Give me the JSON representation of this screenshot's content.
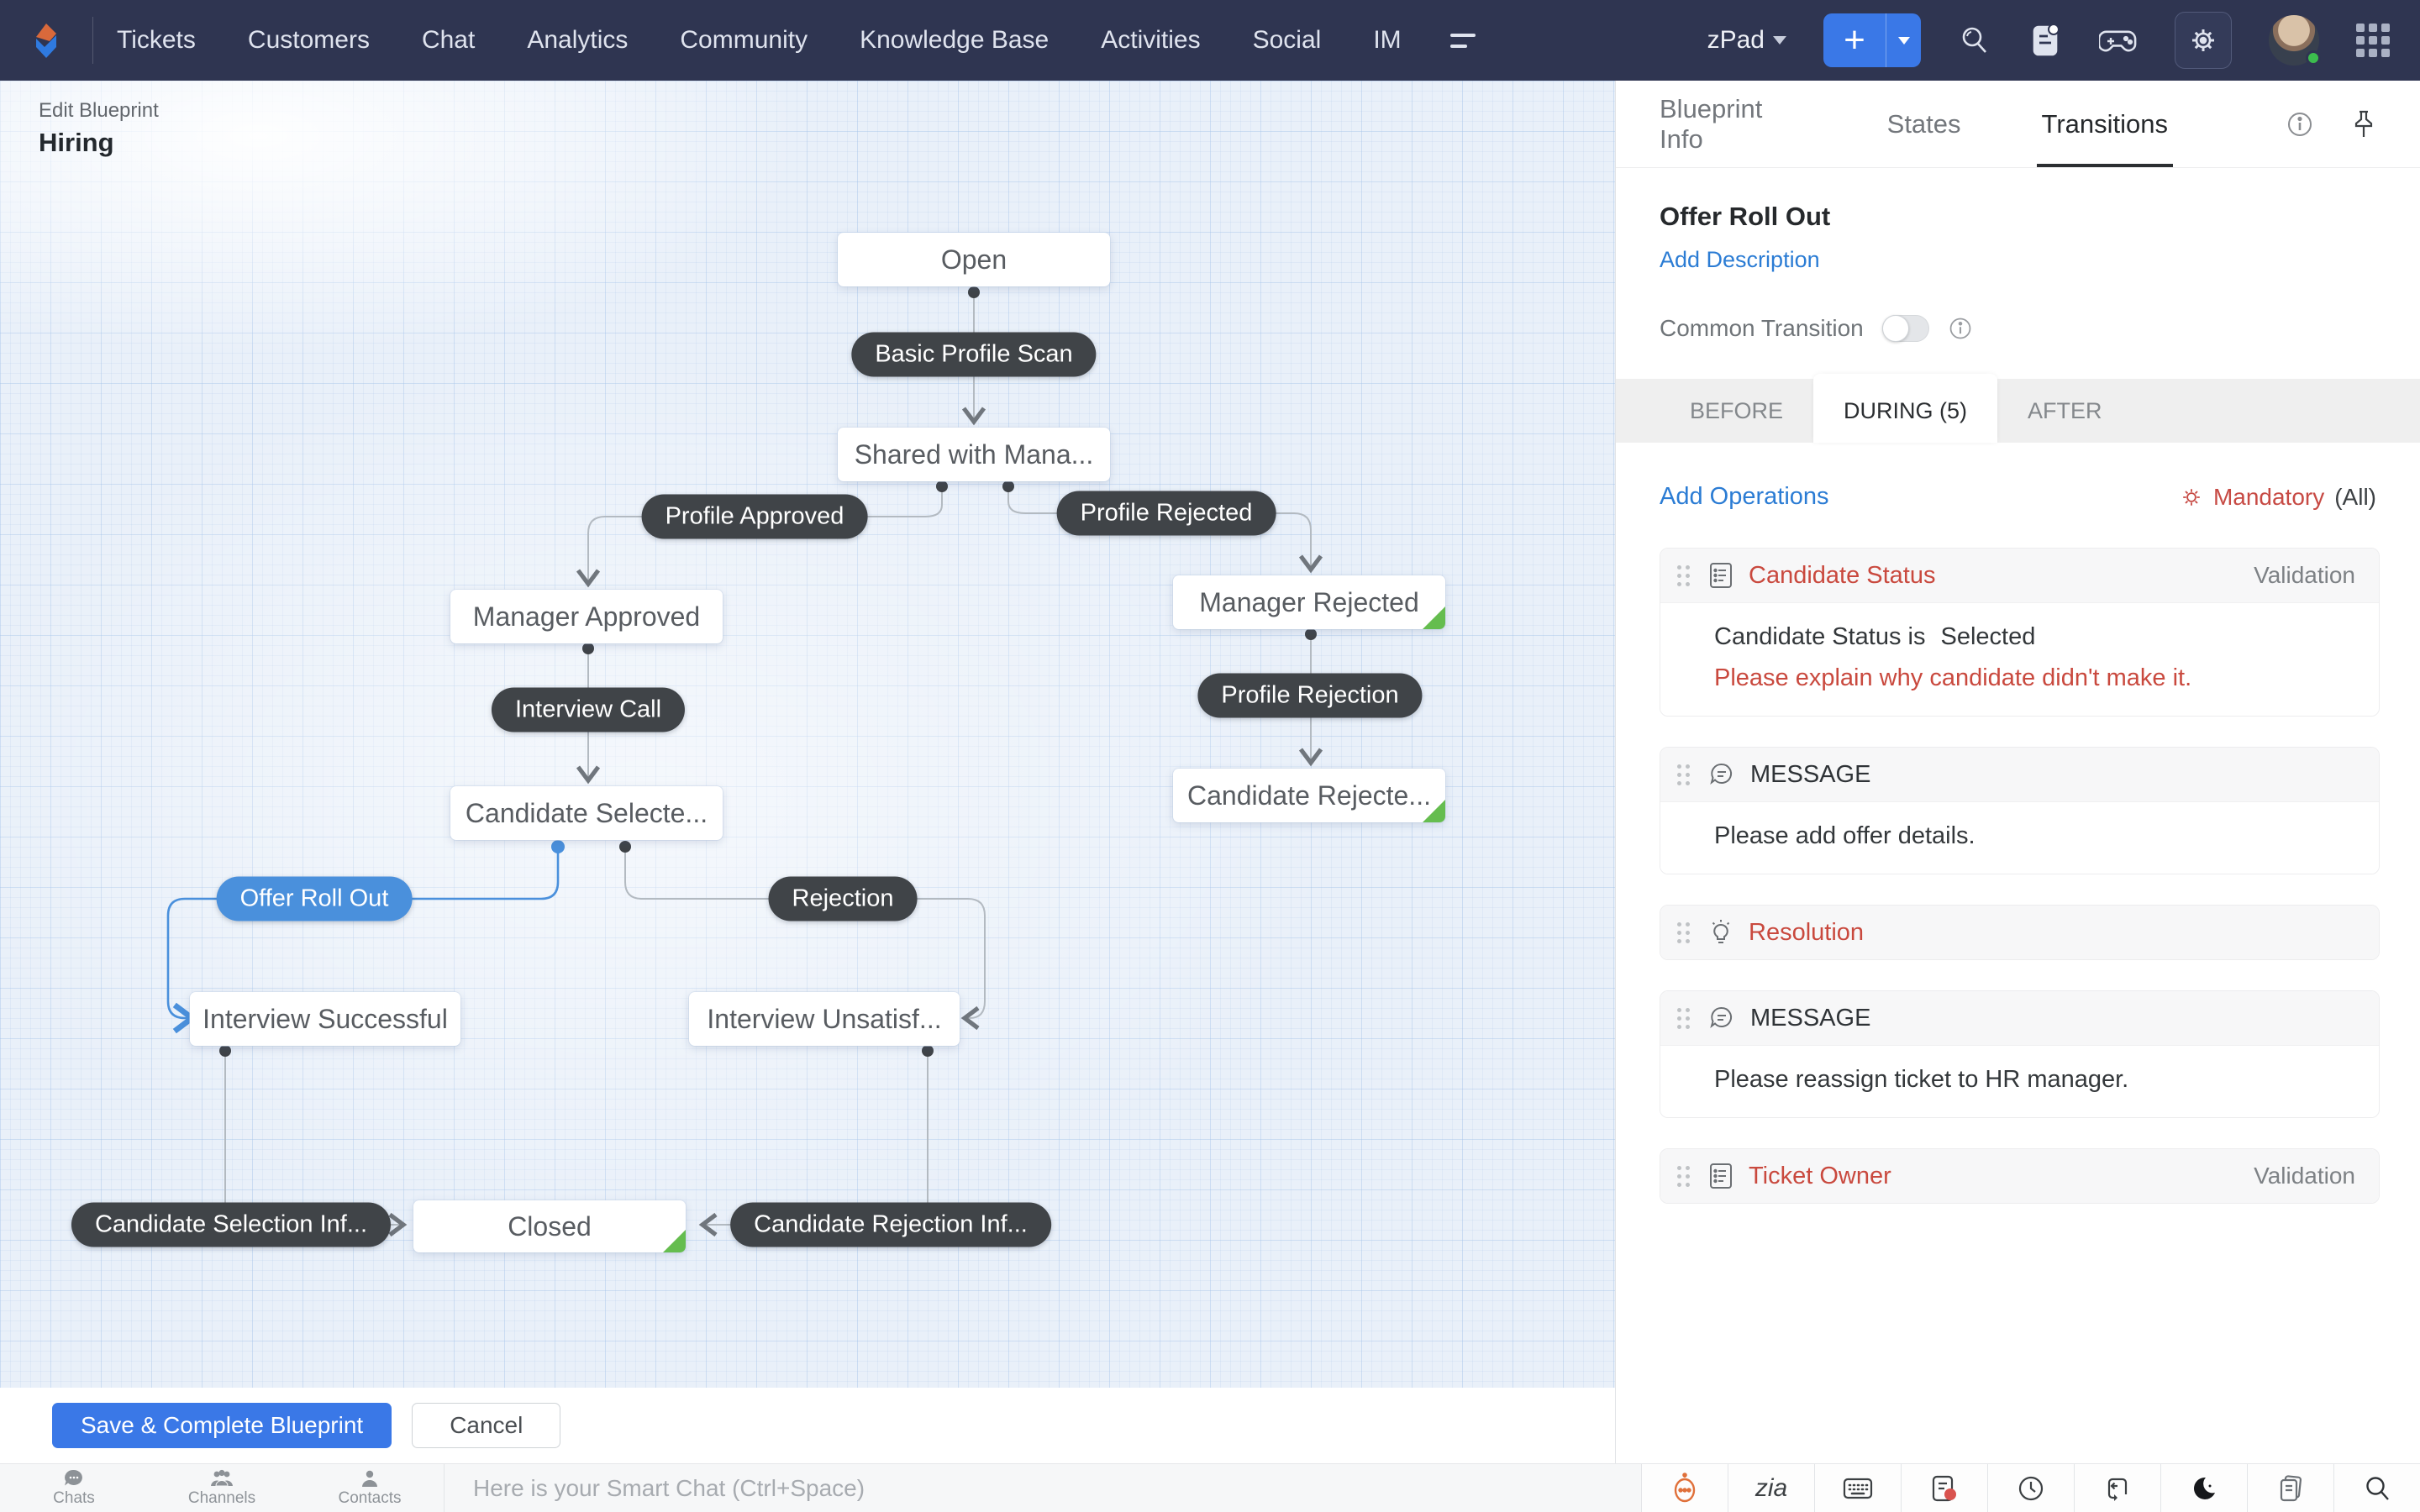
{
  "nav": {
    "items": [
      "Tickets",
      "Customers",
      "Chat",
      "Analytics",
      "Community",
      "Knowledge Base",
      "Activities",
      "Social",
      "IM"
    ],
    "workspace": "zPad",
    "add_label": "+"
  },
  "canvas": {
    "breadcrumb": "Edit Blueprint",
    "title": "Hiring",
    "save_label": "Save & Complete Blueprint",
    "cancel_label": "Cancel"
  },
  "diagram": {
    "states": [
      {
        "label": "Open",
        "end_marker": false
      },
      {
        "label": "Shared with Mana...",
        "end_marker": false
      },
      {
        "label": "Manager Approved",
        "end_marker": false
      },
      {
        "label": "Manager Rejected",
        "end_marker": true
      },
      {
        "label": "Candidate Selecte...",
        "end_marker": false
      },
      {
        "label": "Candidate Rejecte...",
        "end_marker": true
      },
      {
        "label": "Interview Successful",
        "end_marker": false
      },
      {
        "label": "Interview Unsatisf...",
        "end_marker": false
      },
      {
        "label": "Closed",
        "end_marker": true
      }
    ],
    "transitions": [
      {
        "label": "Basic Profile Scan",
        "selected": false
      },
      {
        "label": "Profile Approved",
        "selected": false
      },
      {
        "label": "Profile Rejected",
        "selected": false
      },
      {
        "label": "Interview Call",
        "selected": false
      },
      {
        "label": "Profile Rejection",
        "selected": false
      },
      {
        "label": "Offer Roll Out",
        "selected": true
      },
      {
        "label": "Rejection",
        "selected": false
      },
      {
        "label": "Candidate Selection Inf...",
        "selected": false
      },
      {
        "label": "Candidate Rejection Inf...",
        "selected": false
      }
    ],
    "edges": [
      {
        "from": "Open",
        "via": "Basic Profile Scan",
        "to": "Shared with Mana..."
      },
      {
        "from": "Shared with Mana...",
        "via": "Profile Approved",
        "to": "Manager Approved"
      },
      {
        "from": "Shared with Mana...",
        "via": "Profile Rejected",
        "to": "Manager Rejected"
      },
      {
        "from": "Manager Approved",
        "via": "Interview Call",
        "to": "Candidate Selecte..."
      },
      {
        "from": "Manager Rejected",
        "via": "Profile Rejection",
        "to": "Candidate Rejecte..."
      },
      {
        "from": "Candidate Selecte...",
        "via": "Offer Roll Out",
        "to": "Interview Successful"
      },
      {
        "from": "Candidate Selecte...",
        "via": "Rejection",
        "to": "Interview Unsatisf..."
      },
      {
        "from": "Interview Successful",
        "via": "Candidate Selection Inf...",
        "to": "Closed"
      },
      {
        "from": "Interview Unsatisf...",
        "via": "Candidate Rejection Inf...",
        "to": "Closed"
      }
    ]
  },
  "panel": {
    "tabs": [
      "Blueprint Info",
      "States",
      "Transitions"
    ],
    "active_tab": "Transitions",
    "transition_title": "Offer Roll Out",
    "add_description": "Add Description",
    "common_transition_label": "Common Transition",
    "common_transition_on": false,
    "phase_tabs": [
      "BEFORE",
      "DURING (5)",
      "AFTER"
    ],
    "active_phase": "DURING (5)",
    "add_operations": "Add Operations",
    "mandatory_label": "Mandatory",
    "mandatory_suffix": "(All)",
    "operations": [
      {
        "icon": "form",
        "title": "Candidate Status",
        "badge": "Validation",
        "body_line1": "Candidate Status is",
        "body_token": "Selected",
        "body_line2": "Please explain why candidate didn't make it."
      },
      {
        "icon": "message",
        "title": "MESSAGE",
        "body": "Please add offer details."
      },
      {
        "icon": "bulb",
        "title": "Resolution"
      },
      {
        "icon": "message",
        "title": "MESSAGE",
        "body": "Please reassign ticket to HR manager."
      },
      {
        "icon": "form",
        "title": "Ticket Owner",
        "badge": "Validation"
      }
    ]
  },
  "dock": {
    "items": [
      "Chats",
      "Channels",
      "Contacts"
    ],
    "placeholder": "Here is your Smart Chat (Ctrl+Space)",
    "zia_script": "zia"
  },
  "colors": {
    "nav_bg": "#2f3551",
    "accent_blue": "#3a78e7",
    "selected_blue": "#4a90dc",
    "pill_dark": "#404448",
    "alert_red": "#c9493e",
    "end_green": "#65bd4f"
  }
}
